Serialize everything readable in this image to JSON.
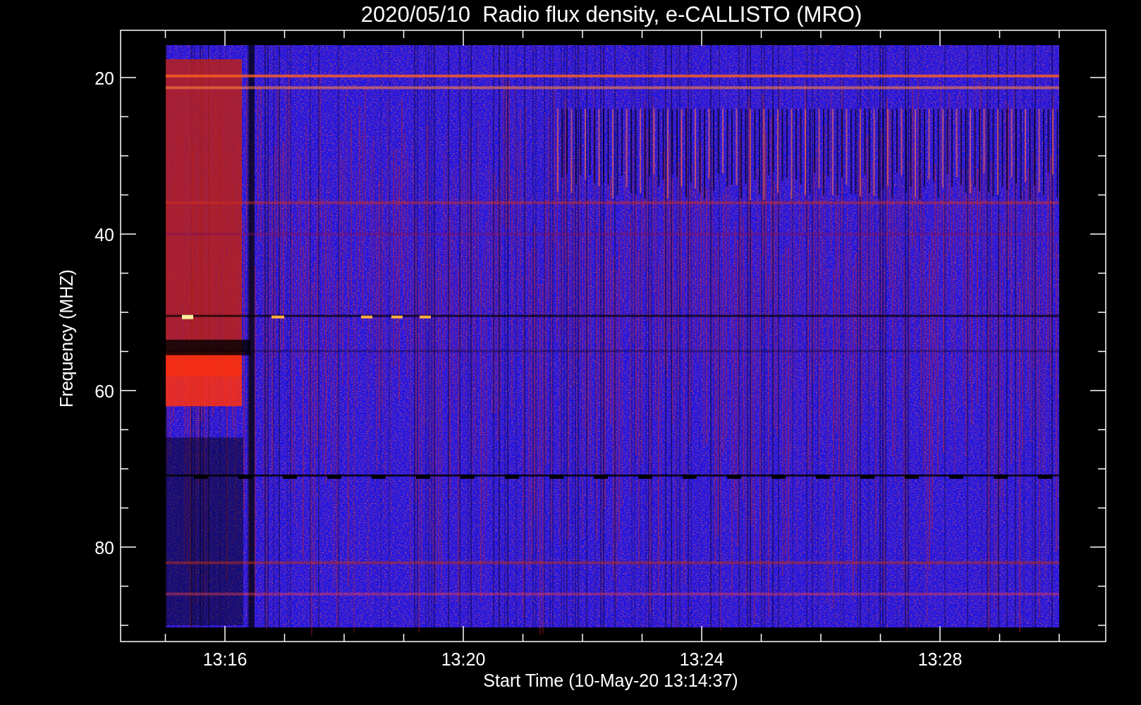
{
  "title": "2020/05/10  Radio flux density, e-CALLISTO (MRO)",
  "plot": {
    "ylabel": "Frequency (MHZ)",
    "xlabel": "Start Time (10-May-20 13:14:37)",
    "yticks": [
      "20",
      "40",
      "60",
      "80"
    ],
    "xticks": [
      "13:16",
      "13:20",
      "13:24",
      "13:28"
    ]
  }
}
